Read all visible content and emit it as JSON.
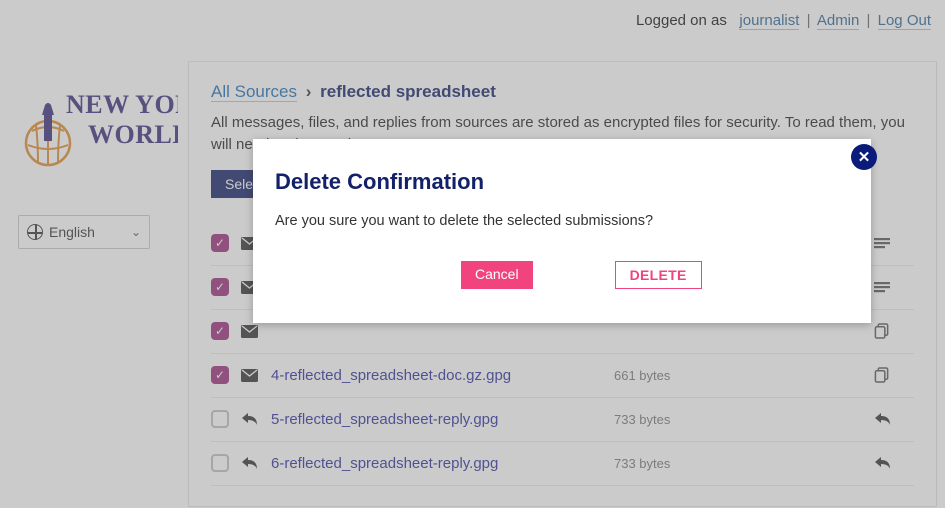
{
  "topbar": {
    "logged_label": "Logged on as",
    "username": "journalist",
    "admin": "Admin",
    "logout": "Log Out"
  },
  "sidebar": {
    "logo_line1": "NEW YORK",
    "logo_line2": "WORLD",
    "language": "English"
  },
  "breadcrumb": {
    "root": "All Sources",
    "current": "reflected spreadsheet"
  },
  "description": "All messages, files, and replies from sources are stored as encrypted files for security. To read them, you will need to decrypt them.",
  "select_button": "Select",
  "rows": [
    {
      "checked": true,
      "icon": "mail",
      "name": "",
      "size": "",
      "action": "notes"
    },
    {
      "checked": true,
      "icon": "mail",
      "name": "",
      "size": "",
      "action": "notes"
    },
    {
      "checked": true,
      "icon": "mail",
      "name": "",
      "size": "",
      "action": "copy"
    },
    {
      "checked": true,
      "icon": "mail",
      "name": "4-reflected_spreadsheet-doc.gz.gpg",
      "size": "661 bytes",
      "action": "copy"
    },
    {
      "checked": false,
      "icon": "reply",
      "name": "5-reflected_spreadsheet-reply.gpg",
      "size": "733 bytes",
      "action": "reply"
    },
    {
      "checked": false,
      "icon": "reply",
      "name": "6-reflected_spreadsheet-reply.gpg",
      "size": "733 bytes",
      "action": "reply"
    }
  ],
  "dialog": {
    "title": "Delete Confirmation",
    "message": "Are you sure you want to delete the selected submissions?",
    "cancel": "Cancel",
    "delete": "DELETE"
  }
}
